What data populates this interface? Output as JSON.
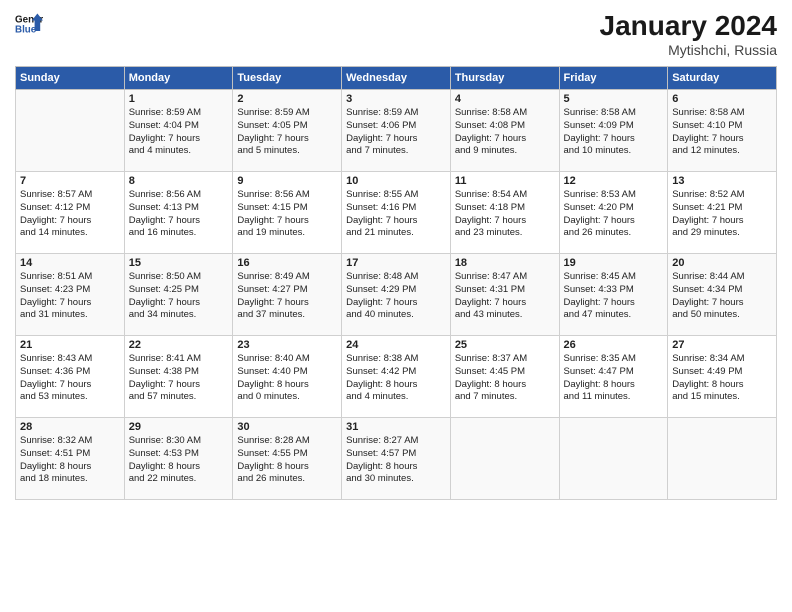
{
  "header": {
    "month_title": "January 2024",
    "location": "Mytishchi, Russia"
  },
  "columns": [
    "Sunday",
    "Monday",
    "Tuesday",
    "Wednesday",
    "Thursday",
    "Friday",
    "Saturday"
  ],
  "rows": [
    [
      {
        "day": "",
        "lines": []
      },
      {
        "day": "1",
        "lines": [
          "Sunrise: 8:59 AM",
          "Sunset: 4:04 PM",
          "Daylight: 7 hours",
          "and 4 minutes."
        ]
      },
      {
        "day": "2",
        "lines": [
          "Sunrise: 8:59 AM",
          "Sunset: 4:05 PM",
          "Daylight: 7 hours",
          "and 5 minutes."
        ]
      },
      {
        "day": "3",
        "lines": [
          "Sunrise: 8:59 AM",
          "Sunset: 4:06 PM",
          "Daylight: 7 hours",
          "and 7 minutes."
        ]
      },
      {
        "day": "4",
        "lines": [
          "Sunrise: 8:58 AM",
          "Sunset: 4:08 PM",
          "Daylight: 7 hours",
          "and 9 minutes."
        ]
      },
      {
        "day": "5",
        "lines": [
          "Sunrise: 8:58 AM",
          "Sunset: 4:09 PM",
          "Daylight: 7 hours",
          "and 10 minutes."
        ]
      },
      {
        "day": "6",
        "lines": [
          "Sunrise: 8:58 AM",
          "Sunset: 4:10 PM",
          "Daylight: 7 hours",
          "and 12 minutes."
        ]
      }
    ],
    [
      {
        "day": "7",
        "lines": [
          "Sunrise: 8:57 AM",
          "Sunset: 4:12 PM",
          "Daylight: 7 hours",
          "and 14 minutes."
        ]
      },
      {
        "day": "8",
        "lines": [
          "Sunrise: 8:56 AM",
          "Sunset: 4:13 PM",
          "Daylight: 7 hours",
          "and 16 minutes."
        ]
      },
      {
        "day": "9",
        "lines": [
          "Sunrise: 8:56 AM",
          "Sunset: 4:15 PM",
          "Daylight: 7 hours",
          "and 19 minutes."
        ]
      },
      {
        "day": "10",
        "lines": [
          "Sunrise: 8:55 AM",
          "Sunset: 4:16 PM",
          "Daylight: 7 hours",
          "and 21 minutes."
        ]
      },
      {
        "day": "11",
        "lines": [
          "Sunrise: 8:54 AM",
          "Sunset: 4:18 PM",
          "Daylight: 7 hours",
          "and 23 minutes."
        ]
      },
      {
        "day": "12",
        "lines": [
          "Sunrise: 8:53 AM",
          "Sunset: 4:20 PM",
          "Daylight: 7 hours",
          "and 26 minutes."
        ]
      },
      {
        "day": "13",
        "lines": [
          "Sunrise: 8:52 AM",
          "Sunset: 4:21 PM",
          "Daylight: 7 hours",
          "and 29 minutes."
        ]
      }
    ],
    [
      {
        "day": "14",
        "lines": [
          "Sunrise: 8:51 AM",
          "Sunset: 4:23 PM",
          "Daylight: 7 hours",
          "and 31 minutes."
        ]
      },
      {
        "day": "15",
        "lines": [
          "Sunrise: 8:50 AM",
          "Sunset: 4:25 PM",
          "Daylight: 7 hours",
          "and 34 minutes."
        ]
      },
      {
        "day": "16",
        "lines": [
          "Sunrise: 8:49 AM",
          "Sunset: 4:27 PM",
          "Daylight: 7 hours",
          "and 37 minutes."
        ]
      },
      {
        "day": "17",
        "lines": [
          "Sunrise: 8:48 AM",
          "Sunset: 4:29 PM",
          "Daylight: 7 hours",
          "and 40 minutes."
        ]
      },
      {
        "day": "18",
        "lines": [
          "Sunrise: 8:47 AM",
          "Sunset: 4:31 PM",
          "Daylight: 7 hours",
          "and 43 minutes."
        ]
      },
      {
        "day": "19",
        "lines": [
          "Sunrise: 8:45 AM",
          "Sunset: 4:33 PM",
          "Daylight: 7 hours",
          "and 47 minutes."
        ]
      },
      {
        "day": "20",
        "lines": [
          "Sunrise: 8:44 AM",
          "Sunset: 4:34 PM",
          "Daylight: 7 hours",
          "and 50 minutes."
        ]
      }
    ],
    [
      {
        "day": "21",
        "lines": [
          "Sunrise: 8:43 AM",
          "Sunset: 4:36 PM",
          "Daylight: 7 hours",
          "and 53 minutes."
        ]
      },
      {
        "day": "22",
        "lines": [
          "Sunrise: 8:41 AM",
          "Sunset: 4:38 PM",
          "Daylight: 7 hours",
          "and 57 minutes."
        ]
      },
      {
        "day": "23",
        "lines": [
          "Sunrise: 8:40 AM",
          "Sunset: 4:40 PM",
          "Daylight: 8 hours",
          "and 0 minutes."
        ]
      },
      {
        "day": "24",
        "lines": [
          "Sunrise: 8:38 AM",
          "Sunset: 4:42 PM",
          "Daylight: 8 hours",
          "and 4 minutes."
        ]
      },
      {
        "day": "25",
        "lines": [
          "Sunrise: 8:37 AM",
          "Sunset: 4:45 PM",
          "Daylight: 8 hours",
          "and 7 minutes."
        ]
      },
      {
        "day": "26",
        "lines": [
          "Sunrise: 8:35 AM",
          "Sunset: 4:47 PM",
          "Daylight: 8 hours",
          "and 11 minutes."
        ]
      },
      {
        "day": "27",
        "lines": [
          "Sunrise: 8:34 AM",
          "Sunset: 4:49 PM",
          "Daylight: 8 hours",
          "and 15 minutes."
        ]
      }
    ],
    [
      {
        "day": "28",
        "lines": [
          "Sunrise: 8:32 AM",
          "Sunset: 4:51 PM",
          "Daylight: 8 hours",
          "and 18 minutes."
        ]
      },
      {
        "day": "29",
        "lines": [
          "Sunrise: 8:30 AM",
          "Sunset: 4:53 PM",
          "Daylight: 8 hours",
          "and 22 minutes."
        ]
      },
      {
        "day": "30",
        "lines": [
          "Sunrise: 8:28 AM",
          "Sunset: 4:55 PM",
          "Daylight: 8 hours",
          "and 26 minutes."
        ]
      },
      {
        "day": "31",
        "lines": [
          "Sunrise: 8:27 AM",
          "Sunset: 4:57 PM",
          "Daylight: 8 hours",
          "and 30 minutes."
        ]
      },
      {
        "day": "",
        "lines": []
      },
      {
        "day": "",
        "lines": []
      },
      {
        "day": "",
        "lines": []
      }
    ]
  ]
}
